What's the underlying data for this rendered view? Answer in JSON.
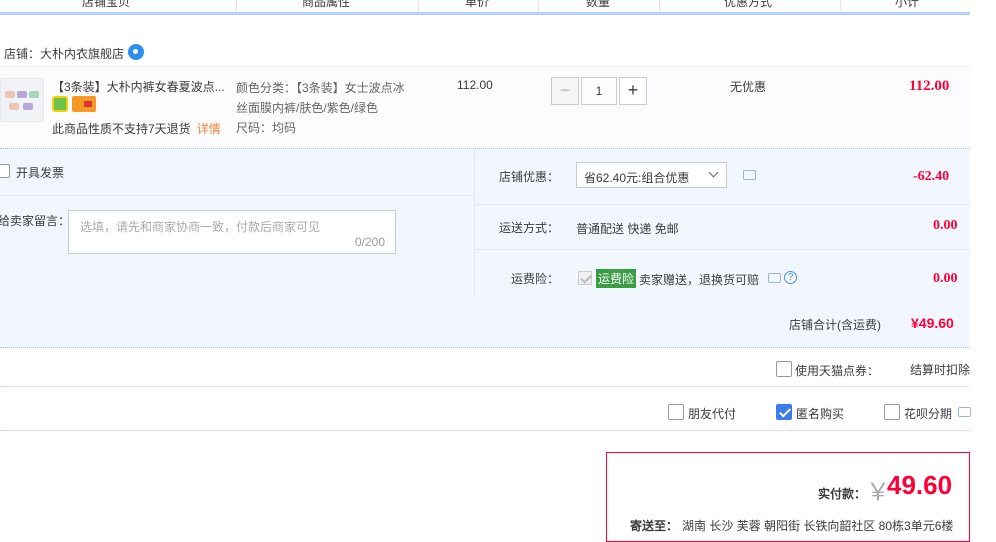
{
  "header": {
    "columns": [
      "店铺宝贝",
      "商品属性",
      "单价",
      "数量",
      "优惠方式",
      "小计"
    ]
  },
  "shop": {
    "name_label": "店铺：大朴内衣旗舰店"
  },
  "item": {
    "title": "【3条装】大朴内裤女春夏波点...",
    "notice": "此商品性质不支持7天退货",
    "detail_link": "详情",
    "attr_line1": "颜色分类：【3条装】女士波点冰",
    "attr_line2": "丝面膜内裤/肤色/紫色/绿色",
    "attr_line3": "尺码：均码",
    "price": "112.00",
    "quantity": "1",
    "discount": "无优惠",
    "subtotal": "112.00"
  },
  "options": {
    "invoice_label": "开具发票",
    "message_label": "给卖家留言：",
    "message_placeholder": "选填，请先和商家协商一致，付款后商家可见",
    "message_counter": "0/200",
    "shop_discount_label": "店铺优惠：",
    "shop_discount_select": "省62.40元:组合优惠",
    "shop_discount_amount": "-62.40",
    "shipping_label": "运送方式：",
    "shipping_value": "普通配送 快递 免邮",
    "shipping_amount": "0.00",
    "insurance_label": "运费险：",
    "insurance_badge": "运费险",
    "insurance_text": "卖家赠送，退换货可赔",
    "insurance_amount": "0.00",
    "help_glyph": "?"
  },
  "shop_total": {
    "label": "店铺合计(含运费)",
    "value": "¥49.60"
  },
  "tmall_points": {
    "label": "使用天猫点券：",
    "note": "结算时扣除"
  },
  "extras": {
    "friend_pay": "朋友代付",
    "anonymous": "匿名购买",
    "huabei": "花呗分期"
  },
  "payment": {
    "label": "实付款：",
    "currency": "￥",
    "amount": "49.60",
    "ship_to_label": "寄送至：",
    "address": "湖南 长沙 芙蓉 朝阳街 长铁向韶社区 80栋3单元6楼"
  },
  "colors": {
    "accent_red": "#ff0036",
    "accent_blue": "#3b7bea",
    "panel_bg": "#f2f7ff"
  }
}
